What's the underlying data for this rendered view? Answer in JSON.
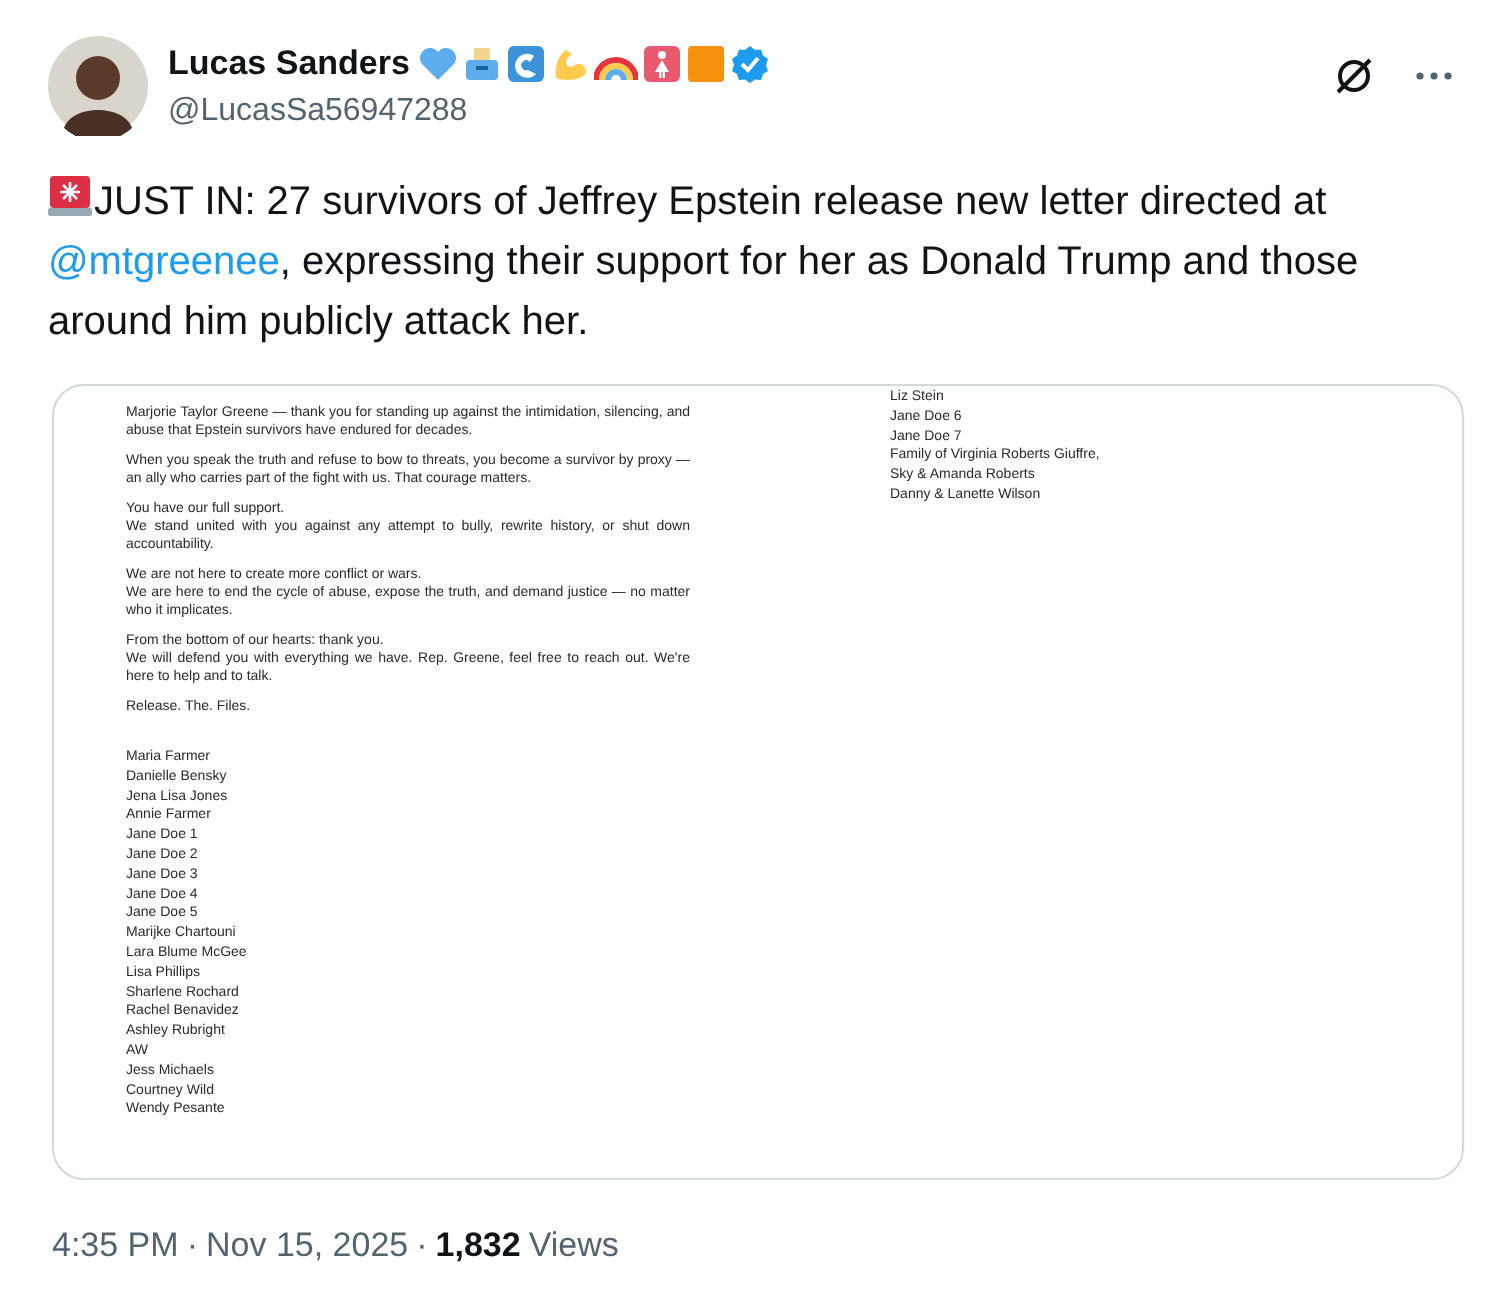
{
  "author": {
    "name": "Lucas Sanders",
    "handle": "@LucasSa56947288"
  },
  "tweet": {
    "parts": [
      {
        "kind": "text",
        "text": "JUST IN: 27 survivors of Jeffrey Epstein release new letter directed at "
      },
      {
        "kind": "mention",
        "text": "@mtgreenee"
      },
      {
        "kind": "text",
        "text": ", expressing their support for her as Donald Trump and those around him publicly attack her."
      }
    ]
  },
  "document": {
    "paragraphs": [
      [
        "Marjorie Taylor Greene — thank you for standing up against the intimidation, silencing, and abuse that Epstein survivors have endured for decades."
      ],
      [
        "When you speak the truth and refuse to bow to threats, you become a survivor by proxy — an ally who carries part of the fight with us. That courage matters."
      ],
      [
        "You have our full support.",
        "We stand united with you against any attempt to bully, rewrite history, or shut down accountability."
      ],
      [
        "We are not here to create more conflict or wars.",
        "We are here to end the cycle of abuse, expose the truth, and demand justice — no matter who it implicates."
      ],
      [
        "From the bottom of our hearts: thank you.",
        "We will defend you with everything we have. Rep. Greene, feel free to reach out. We're here to help and to talk."
      ],
      [
        "Release. The. Files."
      ]
    ],
    "names_left": [
      "Maria Farmer",
      "Danielle Bensky",
      "Jena Lisa Jones",
      "Annie Farmer",
      "Jane Doe 1",
      "Jane Doe 2",
      "Jane Doe 3",
      "Jane Doe 4",
      "Jane Doe 5",
      "Marijke Chartouni",
      "Lara Blume McGee",
      "Lisa Phillips",
      "Sharlene Rochard",
      "Rachel Benavidez",
      "Ashley Rubright",
      "AW",
      "Jess Michaels",
      "Courtney Wild",
      "Wendy Pesante"
    ],
    "names_right": [
      "Liz Stein",
      "Jane Doe 6",
      "Jane Doe 7",
      "Family of Virginia Roberts Giuffre,",
      "Sky & Amanda Roberts",
      "Danny & Lanette Wilson"
    ]
  },
  "footer": {
    "time": "4:35 PM",
    "separator": "·",
    "date": "Nov 15, 2025",
    "views_count": "1,832",
    "views_label": "Views"
  }
}
